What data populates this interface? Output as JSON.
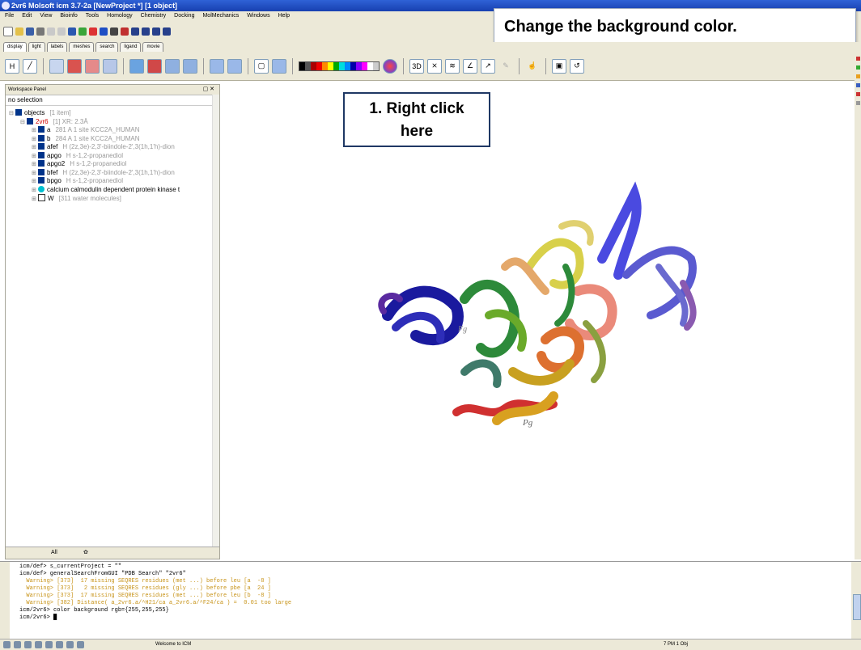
{
  "window": {
    "title": "2vr6 Molsoft icm 3.7-2a [NewProject *] [1 object]"
  },
  "menu": [
    "File",
    "Edit",
    "View",
    "Bioinfo",
    "Tools",
    "Homology",
    "Chemistry",
    "Docking",
    "MolMechanics",
    "Windows",
    "Help"
  ],
  "tabs": [
    "display",
    "light",
    "labels",
    "meshes",
    "search",
    "ligand",
    "movie"
  ],
  "annotations": {
    "top": "Change the background color.",
    "step1_line1": "1. Right click",
    "step1_line2": "here"
  },
  "workspace": {
    "header": "Workspace Panel",
    "selection": "no selection",
    "tree": [
      {
        "name": "objects",
        "info": "[1 item]",
        "level": 0,
        "box": "filled"
      },
      {
        "name": "2vr6",
        "info": "[1] XR: 2.3Å",
        "level": 1,
        "box": "filled",
        "red": true
      },
      {
        "name": "a",
        "info": "281 A  1 site KCC2A_HUMAN",
        "level": 2,
        "box": "filled"
      },
      {
        "name": "b",
        "info": "284 A  1 site KCC2A_HUMAN",
        "level": 2,
        "box": "filled"
      },
      {
        "name": "afef",
        "info": "H  (2z,3e)-2,3'-biindole-2',3(1h,1'h)-dion",
        "level": 2,
        "box": "filled"
      },
      {
        "name": "apgo",
        "info": "H  s-1,2-propanediol",
        "level": 2,
        "box": "filled"
      },
      {
        "name": "apgo2",
        "info": "H  s-1,2-propanediol",
        "level": 2,
        "box": "filled"
      },
      {
        "name": "bfef",
        "info": "H  (2z,3e)-2,3'-biindole-2',3(1h,1'h)-dion",
        "level": 2,
        "box": "filled"
      },
      {
        "name": "bpgo",
        "info": "H  s-1,2-propanediol",
        "level": 2,
        "box": "filled"
      },
      {
        "name": "calcium calmodulin dependent protein kinase t",
        "info": "",
        "level": 2,
        "box": "cyan"
      },
      {
        "name": "W",
        "info": "[311 water molecules]",
        "level": 2,
        "box": "empty"
      }
    ],
    "footer_tab1": "All",
    "footer_tab2": "✿"
  },
  "viewer": {
    "labels": [
      "Fg",
      "Pg"
    ]
  },
  "console": {
    "lines": [
      {
        "text": "icm/def> s_currentProject = \"\"",
        "warn": false
      },
      {
        "text": "icm/def> generalSearchFromGUI \"PDB Search\" \"2vr6\"",
        "warn": false
      },
      {
        "text": "  Warning> [373]  17 missing SEQRES residues (met ...) before leu [a  -8 ]",
        "warn": true
      },
      {
        "text": "  Warning> [373]   2 missing SEQRES residues (gly ...) before pbe [a  24 ]",
        "warn": true
      },
      {
        "text": "  Warning> [373]  17 missing SEQRES residues (met ...) before leu [b  -8 ]",
        "warn": true
      },
      {
        "text": "  Warning> [382] Distance( a_2vr6.a/^H21/ca a_2vr6.a/^F24/ca ) =  0.01 too large",
        "warn": true
      },
      {
        "text": "icm/2vr6> color background rgb={255,255,255}",
        "warn": false
      },
      {
        "text": "icm/2vr6> █",
        "warn": false
      }
    ]
  },
  "status": {
    "welcome": "Welcome to ICM",
    "stats": "7 PM 1 Obj"
  },
  "colors": {
    "title_blue": "#1f4fc4",
    "chrome": "#ece9d8",
    "dark_navy": "#00338a",
    "warning": "#c8941a"
  }
}
